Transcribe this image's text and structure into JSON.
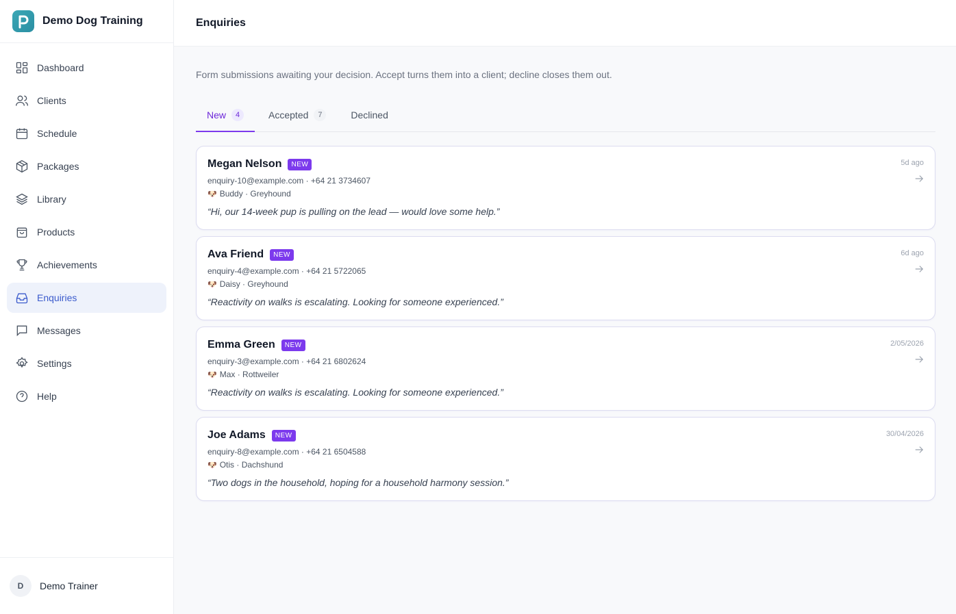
{
  "brand": {
    "name": "Demo Dog Training"
  },
  "nav": [
    {
      "label": "Dashboard",
      "icon": "dashboard-icon"
    },
    {
      "label": "Clients",
      "icon": "users-icon"
    },
    {
      "label": "Schedule",
      "icon": "calendar-icon"
    },
    {
      "label": "Packages",
      "icon": "package-icon"
    },
    {
      "label": "Library",
      "icon": "layers-icon"
    },
    {
      "label": "Products",
      "icon": "shopping-bag-icon"
    },
    {
      "label": "Achievements",
      "icon": "trophy-icon"
    },
    {
      "label": "Enquiries",
      "icon": "inbox-icon",
      "active": true
    },
    {
      "label": "Messages",
      "icon": "message-icon"
    },
    {
      "label": "Settings",
      "icon": "gear-icon"
    },
    {
      "label": "Help",
      "icon": "help-icon"
    }
  ],
  "user": {
    "initial": "D",
    "name": "Demo Trainer"
  },
  "header": {
    "title": "Enquiries"
  },
  "main": {
    "subtitle": "Form submissions awaiting your decision. Accept turns them into a client; decline closes them out.",
    "tabs": [
      {
        "label": "New",
        "count": "4",
        "active": true
      },
      {
        "label": "Accepted",
        "count": "7"
      },
      {
        "label": "Declined",
        "count": ""
      }
    ],
    "enquiries": [
      {
        "name": "Megan Nelson",
        "badge": "NEW",
        "contact": "enquiry-10@example.com · +64 21 3734607",
        "dog": "Buddy · Greyhound",
        "quote": "“Hi, our 14-week pup is pulling on the lead — would love some help.”",
        "time": "5d ago"
      },
      {
        "name": "Ava Friend",
        "badge": "NEW",
        "contact": "enquiry-4@example.com · +64 21 5722065",
        "dog": "Daisy · Greyhound",
        "quote": "“Reactivity on walks is escalating. Looking for someone experienced.”",
        "time": "6d ago"
      },
      {
        "name": "Emma Green",
        "badge": "NEW",
        "contact": "enquiry-3@example.com · +64 21 6802624",
        "dog": "Max · Rottweiler",
        "quote": "“Reactivity on walks is escalating. Looking for someone experienced.”",
        "time": "2/05/2026"
      },
      {
        "name": "Joe Adams",
        "badge": "NEW",
        "contact": "enquiry-8@example.com · +64 21 6504588",
        "dog": "Otis · Dachshund",
        "quote": "“Two dogs in the household, hoping for a household harmony session.”",
        "time": "30/04/2026"
      }
    ]
  },
  "colors": {
    "accent": "#7c3aed",
    "nav_active": "#3b5bcc",
    "brand": "#3ba7b5"
  }
}
